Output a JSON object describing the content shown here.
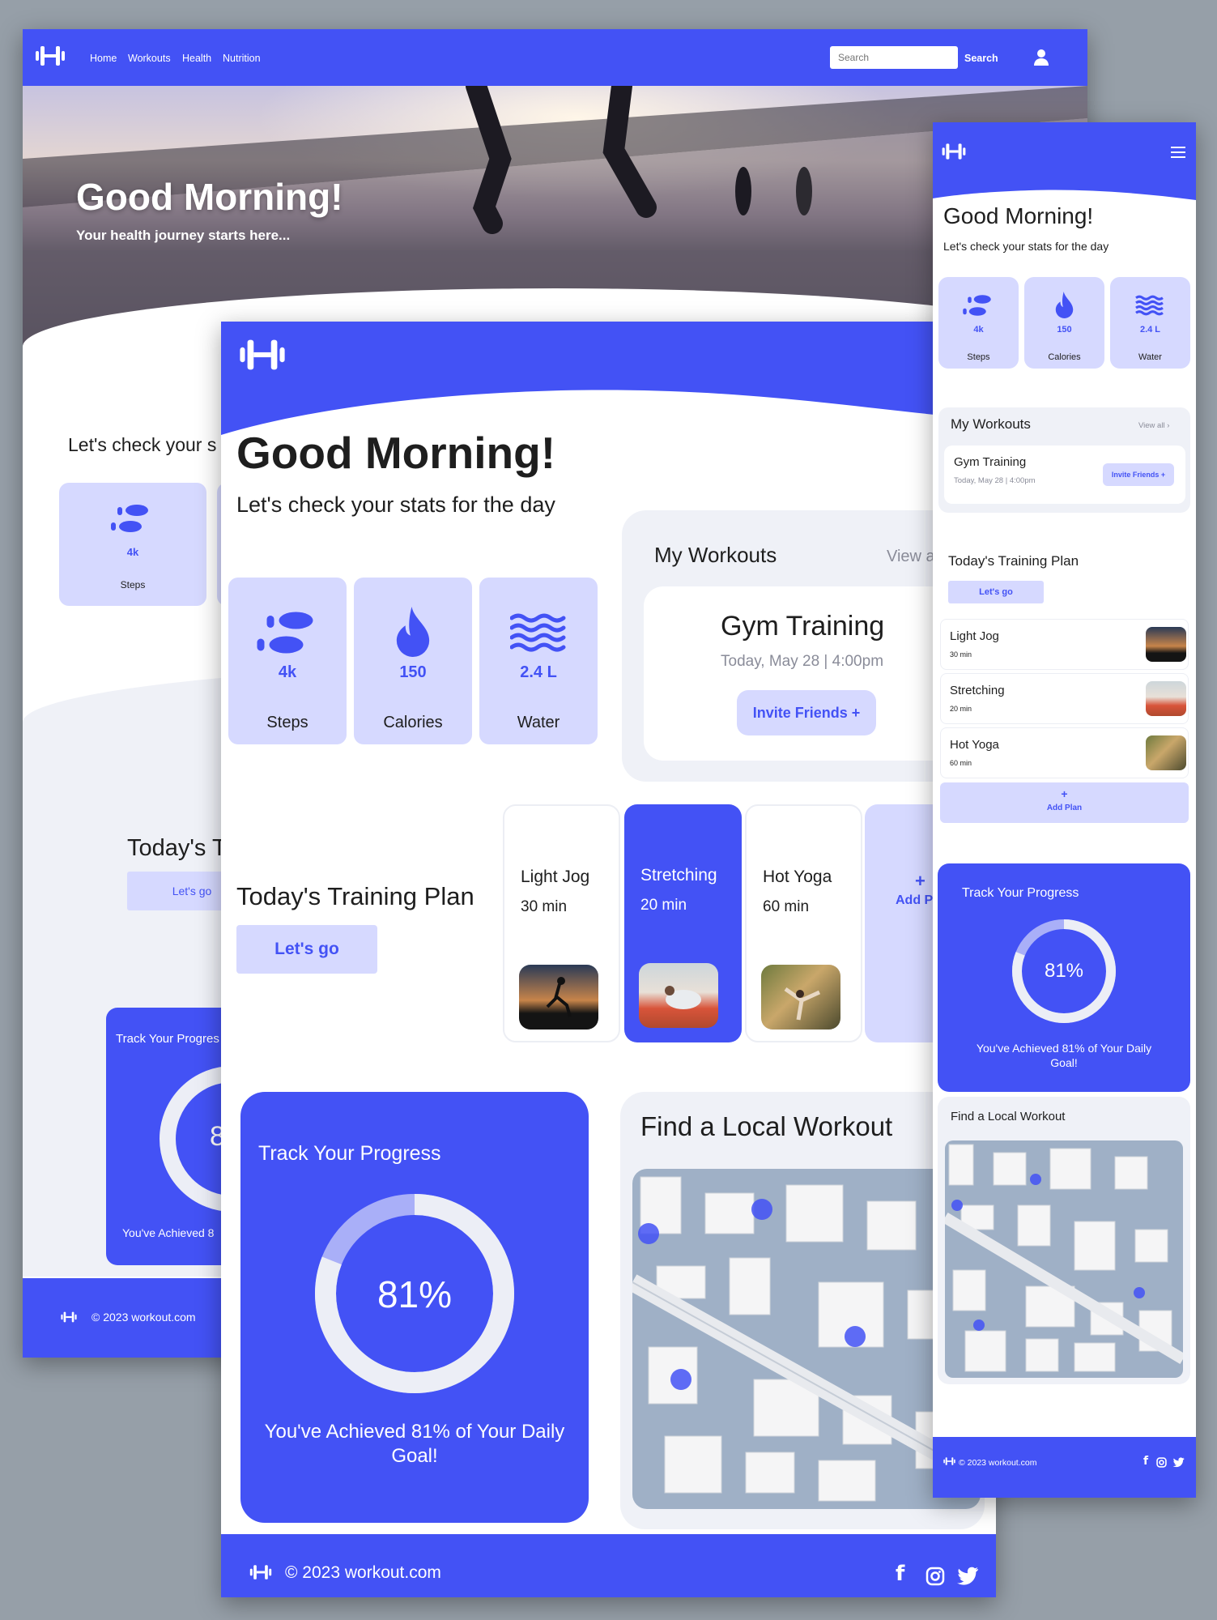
{
  "brand": {
    "primary": "#4352f5",
    "light": "#d6d9ff",
    "panel": "#eff1f7",
    "bg": "#969fa8"
  },
  "desktop": {
    "nav": {
      "links": [
        "Home",
        "Workouts",
        "Health",
        "Nutrition"
      ],
      "search_placeholder": "Search",
      "search_button": "Search",
      "icon": "user-icon"
    },
    "hero": {
      "title": "Good Morning!",
      "subtitle": "Your health journey starts here..."
    },
    "stats_intro": "Let's check your s",
    "stat": {
      "value": "4k",
      "label": "Steps"
    },
    "training": {
      "title": "Today's T",
      "button": "Let's go"
    },
    "progress": {
      "title": "Track Your Progres",
      "value": "8",
      "caption": "You've Achieved 8"
    },
    "footer": {
      "copyright": "© 2023 workout.com"
    }
  },
  "tablet": {
    "greeting": "Good Morning!",
    "subtitle": "Let's check your stats for the day",
    "stats": [
      {
        "value": "4k",
        "label": "Steps",
        "icon": "footsteps-icon"
      },
      {
        "value": "150",
        "label": "Calories",
        "icon": "flame-icon"
      },
      {
        "value": "2.4 L",
        "label": "Water",
        "icon": "water-icon"
      }
    ],
    "workouts": {
      "title": "My Workouts",
      "view_all": "View a",
      "card": {
        "title": "Gym Training",
        "time": "Today, May 28 | 4:00pm",
        "button": "Invite Friends +"
      }
    },
    "training": {
      "title": "Today's Training Plan",
      "button": "Let's go",
      "plans": [
        {
          "name": "Light Jog",
          "duration": "30 min"
        },
        {
          "name": "Stretching",
          "duration": "20 min"
        },
        {
          "name": "Hot Yoga",
          "duration": "60 min"
        }
      ],
      "add": "Add Pl"
    },
    "progress": {
      "title": "Track Your Progress",
      "percent": 81,
      "value_label": "81%",
      "caption": "You've Achieved 81% of Your Daily Goal!"
    },
    "local": {
      "title": "Find a Local Workout"
    },
    "footer": {
      "copyright": "© 2023 workout.com",
      "social": [
        "facebook-icon",
        "instagram-icon",
        "twitter-icon"
      ]
    }
  },
  "mobile": {
    "greeting": "Good Morning!",
    "subtitle": "Let's check your stats for the day",
    "stats": [
      {
        "value": "4k",
        "label": "Steps"
      },
      {
        "value": "150",
        "label": "Calories"
      },
      {
        "value": "2.4 L",
        "label": "Water"
      }
    ],
    "workouts": {
      "title": "My Workouts",
      "view_all": "View all",
      "card": {
        "title": "Gym Training",
        "time": "Today, May 28 | 4:00pm",
        "button": "Invite Friends"
      }
    },
    "training": {
      "title": "Today's Training Plan",
      "button": "Let's go",
      "plans": [
        {
          "name": "Light Jog",
          "duration": "30 min"
        },
        {
          "name": "Stretching",
          "duration": "20 min"
        },
        {
          "name": "Hot Yoga",
          "duration": "60 min"
        }
      ],
      "add": "Add Plan"
    },
    "progress": {
      "title": "Track Your Progress",
      "percent": 81,
      "value_label": "81%",
      "caption": "You've Achieved 81% of Your Daily Goal!"
    },
    "local": {
      "title": "Find a Local Workout"
    },
    "footer": {
      "copyright": "© 2023 workout.com"
    }
  }
}
